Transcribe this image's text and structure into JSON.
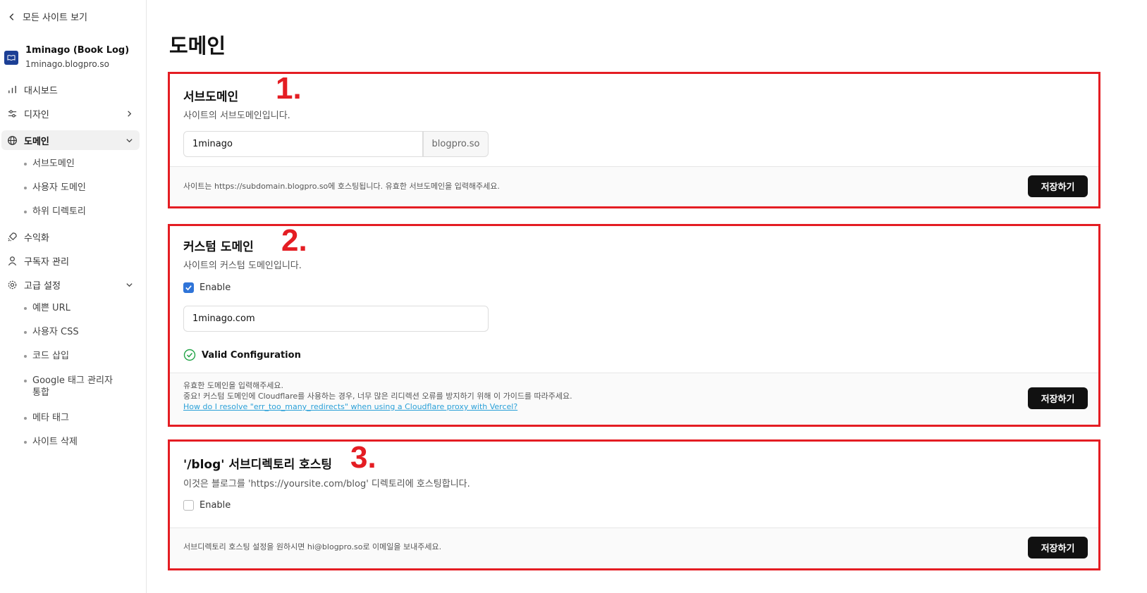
{
  "sidebar": {
    "back_label": "모든 사이트 보기",
    "site_name": "1minago (Book Log)",
    "site_url": "1minago.blogpro.so",
    "items": [
      {
        "label": "대시보드"
      },
      {
        "label": "디자인"
      },
      {
        "label": "도메인"
      },
      {
        "label": "수익화"
      },
      {
        "label": "구독자 관리"
      },
      {
        "label": "고급 설정"
      }
    ],
    "domain_sub": [
      "서브도메인",
      "사용자 도메인",
      "하위 디렉토리"
    ],
    "advanced_sub": [
      "예쁜 URL",
      "사용자 CSS",
      "코드 삽입",
      "Google 태그 관리자 통합",
      "메타 태그",
      "사이트 삭제"
    ]
  },
  "page": {
    "title": "도메인"
  },
  "subdomain": {
    "marker": "1.",
    "title": "서브도메인",
    "desc": "사이트의 서브도메인입니다.",
    "value": "1minago",
    "suffix": "blogpro.so",
    "footer": "사이트는 https://subdomain.blogpro.so에 호스팅됩니다. 유효한 서브도메인을 입력해주세요.",
    "save": "저장하기"
  },
  "custom": {
    "marker": "2.",
    "title": "커스텀 도메인",
    "desc": "사이트의 커스텀 도메인입니다.",
    "enable_label": "Enable",
    "enabled": true,
    "value": "1minago.com",
    "status": "Valid Configuration",
    "footer_line1": "유효한 도메인을 입력해주세요.",
    "footer_line2": "중요! 커스텀 도메인에 Cloudflare를 사용하는 경우, 너무 많은 리디렉션 오류를 방지하기 위해 이 가이드를 따라주세요.",
    "footer_link": "How do I resolve \"err_too_many_redirects\" when using a Cloudflare proxy with Vercel?",
    "save": "저장하기"
  },
  "subdir": {
    "marker": "3.",
    "title": "'/blog' 서브디렉토리 호스팅",
    "desc": "이것은 블로그를 'https://yoursite.com/blog' 디렉토리에 호스팅합니다.",
    "enable_label": "Enable",
    "enabled": false,
    "footer": "서브디렉토리 호스팅 설정을 원하시면 hi@blogpro.so로 이메일을 보내주세요.",
    "save": "저장하기"
  },
  "colors": {
    "accent": "#2f74d8",
    "annotation": "#e41d23",
    "success": "#22a447",
    "link": "#2aa0d8"
  }
}
